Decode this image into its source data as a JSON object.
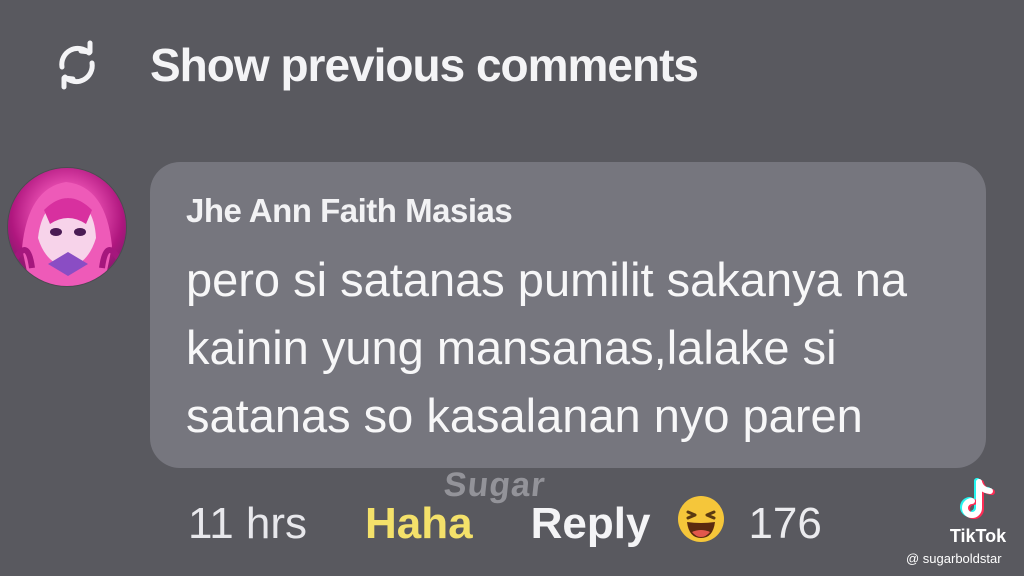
{
  "header": {
    "show_previous_label": "Show previous comments",
    "icon": "refresh-icon"
  },
  "comment": {
    "author": "Jhe Ann Faith Masias",
    "lines": [
      "pero si satanas pumilit sakanya na",
      "kainin yung mansanas,lalake si",
      "satanas so kasalanan nyo paren"
    ],
    "time": "11 hrs",
    "reaction_label": "Haha",
    "reply_label": "Reply",
    "reaction_count": "176",
    "reaction_icon": "haha-emoji-icon"
  },
  "watermarks": {
    "overlay_text": "Sugar",
    "platform": "TikTok",
    "handle": "@ sugarboldstar"
  },
  "colors": {
    "background": "#59595f",
    "bubble": "#76767e",
    "haha": "#f4e16a"
  }
}
